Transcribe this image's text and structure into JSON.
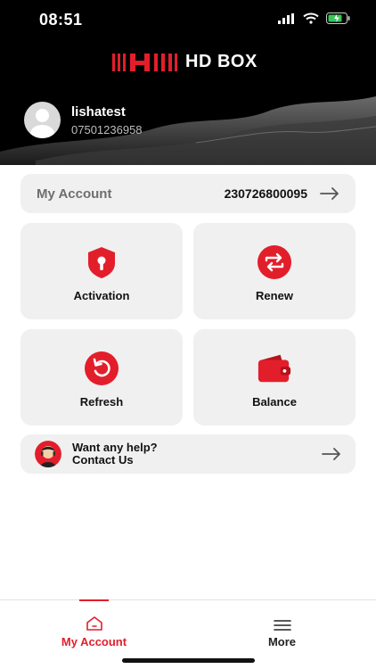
{
  "status_bar": {
    "time": "08:51"
  },
  "brand": {
    "name": "HD BOX"
  },
  "user": {
    "name": "lishatest",
    "phone": "07501236958"
  },
  "account": {
    "label": "My Account",
    "number": "230726800095"
  },
  "actions": [
    {
      "label": "Activation",
      "icon": "shield-key-icon"
    },
    {
      "label": "Renew",
      "icon": "renew-arrows-icon"
    },
    {
      "label": "Refresh",
      "icon": "refresh-icon"
    },
    {
      "label": "Balance",
      "icon": "wallet-icon"
    }
  ],
  "help": {
    "line1": "Want any help?",
    "line2": "Contact Us"
  },
  "tabs": [
    {
      "label": "My Account",
      "icon": "home-icon",
      "active": true
    },
    {
      "label": "More",
      "icon": "menu-icon",
      "active": false
    }
  ],
  "colors": {
    "accent": "#e31e2b",
    "card_bg": "#f0f0f0",
    "header_bg": "#000000"
  }
}
